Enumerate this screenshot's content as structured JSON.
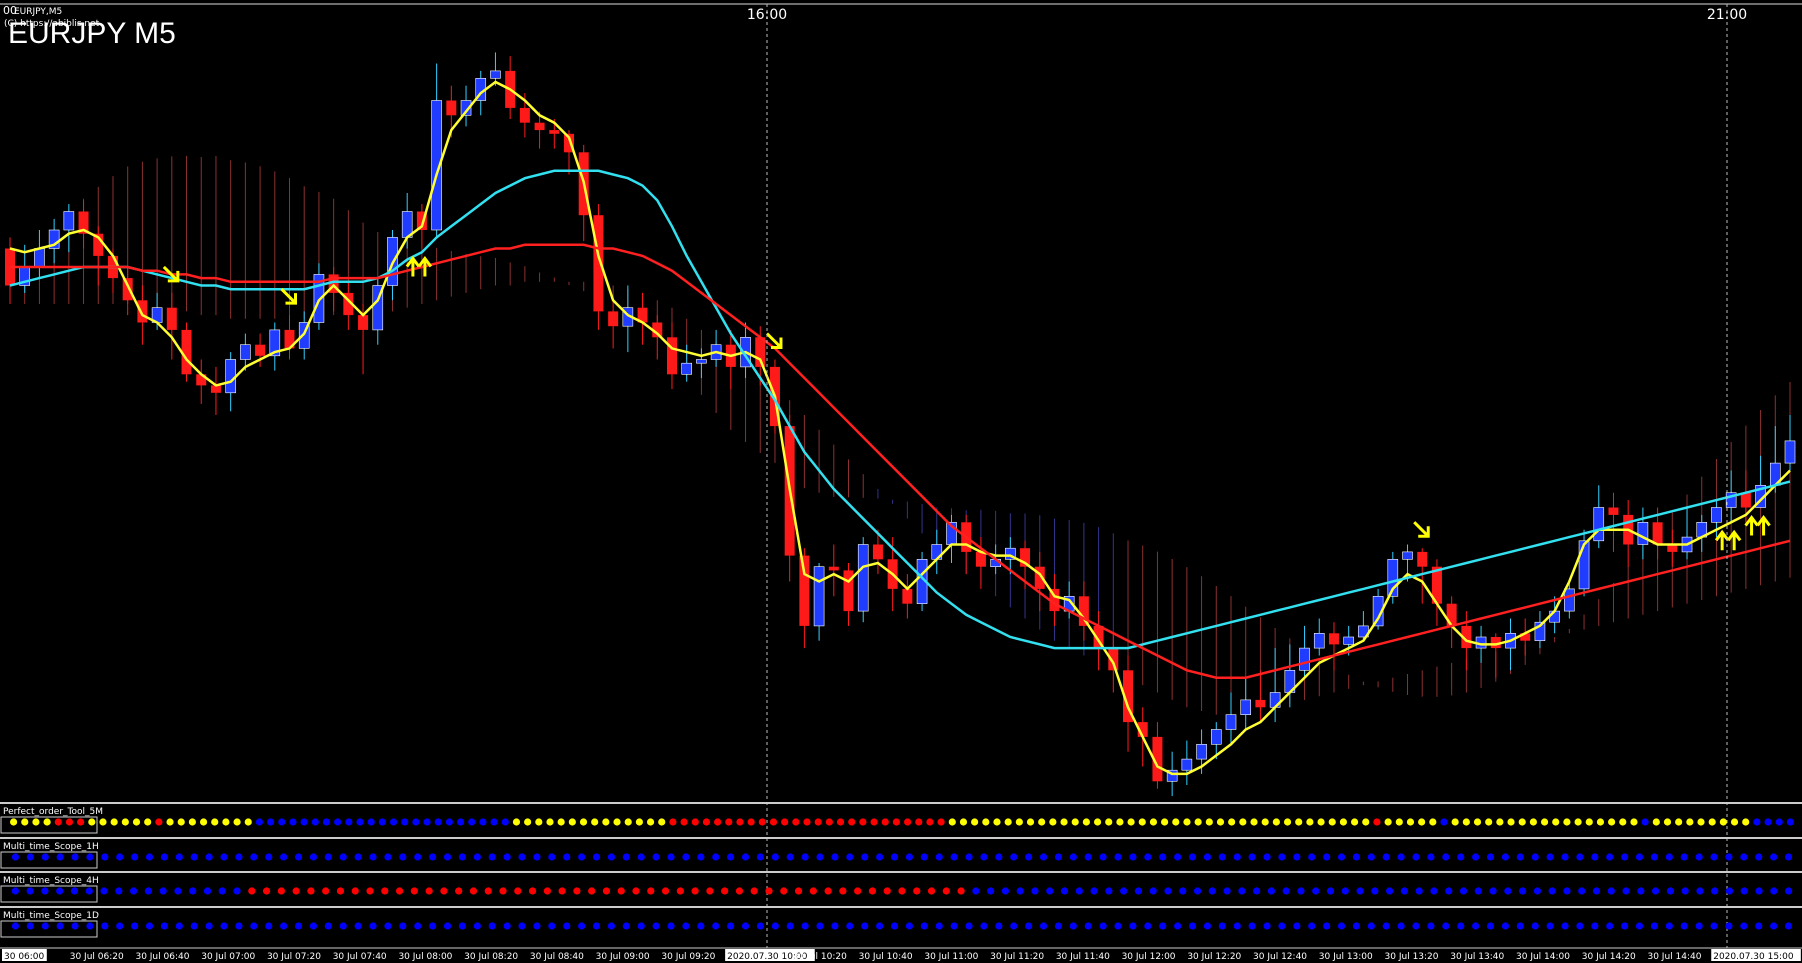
{
  "window": {
    "symbol_small": "EURJPY,M5",
    "copyright": "(C) https://abiblis.net",
    "title": "EURJPY M5",
    "corner_mark": "00"
  },
  "colors": {
    "bullish": "#1f3cff",
    "bearish": "#ff1a1a",
    "ema_fast": "#ffff33",
    "ema_mid": "#33e0f0",
    "ema_slow": "#ff2020",
    "cloud": "#ff5a5a",
    "cloud_alt": "#6060ff",
    "signal": "#ffff00",
    "dot_blue": "#0000ff",
    "dot_red": "#ff0000",
    "dot_yellow": "#ffff00"
  },
  "chart_data": {
    "type": "candlestick",
    "timeframe": "M5",
    "time_separators": [
      "16:00",
      "21:00"
    ],
    "x_ticks": [
      "30 06:00",
      "30 Jul 06:20",
      "30 Jul 06:40",
      "30 Jul 07:00",
      "30 Jul 07:20",
      "30 Jul 07:40",
      "30 Jul 08:00",
      "30 Jul 08:20",
      "30 Jul 08:40",
      "30 Jul 09:00",
      "30 Jul 09:20",
      "2020.07.30 10:00",
      "30 Jul 10:20",
      "30 Jul 10:40",
      "30 Jul 11:00",
      "30 Jul 11:20",
      "30 Jul 11:40",
      "30 Jul 12:00",
      "30 Jul 12:20",
      "30 Jul 12:40",
      "30 Jul 13:00",
      "30 Jul 13:20",
      "30 Jul 13:40",
      "30 Jul 14:00",
      "30 Jul 14:20",
      "30 Jul 14:40",
      "2020.07.30 15:00"
    ],
    "candles": [
      [
        62.0,
        61.9,
        62.03,
        61.85
      ],
      [
        61.9,
        61.95,
        62.01,
        61.88
      ],
      [
        61.95,
        62.0,
        62.05,
        61.92
      ],
      [
        62.0,
        62.05,
        62.08,
        61.96
      ],
      [
        62.05,
        62.1,
        62.12,
        61.99
      ],
      [
        62.1,
        62.04,
        62.13,
        62.0
      ],
      [
        62.04,
        61.98,
        62.06,
        61.9
      ],
      [
        61.98,
        61.92,
        62.0,
        61.88
      ],
      [
        61.92,
        61.86,
        61.95,
        61.82
      ],
      [
        61.86,
        61.8,
        61.9,
        61.74
      ],
      [
        61.8,
        61.84,
        61.88,
        61.78
      ],
      [
        61.84,
        61.78,
        61.88,
        61.7
      ],
      [
        61.78,
        61.66,
        61.8,
        61.64
      ],
      [
        61.66,
        61.63,
        61.7,
        61.58
      ],
      [
        61.63,
        61.61,
        61.68,
        61.55
      ],
      [
        61.61,
        61.7,
        61.72,
        61.56
      ],
      [
        61.7,
        61.74,
        61.77,
        61.67
      ],
      [
        61.74,
        61.71,
        61.77,
        61.68
      ],
      [
        61.71,
        61.78,
        61.8,
        61.67
      ],
      [
        61.78,
        61.73,
        61.82,
        61.7
      ],
      [
        61.73,
        61.8,
        61.83,
        61.7
      ],
      [
        61.8,
        61.93,
        61.96,
        61.78
      ],
      [
        61.93,
        61.88,
        61.95,
        61.83
      ],
      [
        61.88,
        61.82,
        61.91,
        61.78
      ],
      [
        61.82,
        61.78,
        61.85,
        61.66
      ],
      [
        61.78,
        61.9,
        61.92,
        61.74
      ],
      [
        61.9,
        62.03,
        62.05,
        61.86
      ],
      [
        62.03,
        62.1,
        62.15,
        62.0
      ],
      [
        62.1,
        62.05,
        62.12,
        62.0
      ],
      [
        62.05,
        62.4,
        62.5,
        62.03
      ],
      [
        62.4,
        62.36,
        62.44,
        62.3
      ],
      [
        62.36,
        62.4,
        62.44,
        62.33
      ],
      [
        62.4,
        62.46,
        62.48,
        62.36
      ],
      [
        62.46,
        62.48,
        62.53,
        62.44
      ],
      [
        62.48,
        62.38,
        62.52,
        62.35
      ],
      [
        62.38,
        62.34,
        62.42,
        62.3
      ],
      [
        62.34,
        62.32,
        62.37,
        62.27
      ],
      [
        62.32,
        62.31,
        62.35,
        62.27
      ],
      [
        62.31,
        62.26,
        62.32,
        62.2
      ],
      [
        62.26,
        62.09,
        62.28,
        62.02
      ],
      [
        62.09,
        61.83,
        62.12,
        61.78
      ],
      [
        61.83,
        61.79,
        61.86,
        61.73
      ],
      [
        61.79,
        61.84,
        61.9,
        61.72
      ],
      [
        61.84,
        61.8,
        61.88,
        61.74
      ],
      [
        61.8,
        61.76,
        61.82,
        61.7
      ],
      [
        61.76,
        61.66,
        61.8,
        61.62
      ],
      [
        61.66,
        61.69,
        61.74,
        61.64
      ],
      [
        61.69,
        61.7,
        61.73,
        61.65
      ],
      [
        61.7,
        61.74,
        61.78,
        61.68
      ],
      [
        61.74,
        61.68,
        61.78,
        61.62
      ],
      [
        61.68,
        61.76,
        61.8,
        61.65
      ],
      [
        61.76,
        61.68,
        61.79,
        61.63
      ],
      [
        61.68,
        61.52,
        61.7,
        61.5
      ],
      [
        61.52,
        61.17,
        61.55,
        61.1
      ],
      [
        61.17,
        60.98,
        61.19,
        60.92
      ],
      [
        60.98,
        61.14,
        61.15,
        60.94
      ],
      [
        61.14,
        61.13,
        61.2,
        61.06
      ],
      [
        61.13,
        61.02,
        61.15,
        60.98
      ],
      [
        61.02,
        61.2,
        61.22,
        60.99
      ],
      [
        61.2,
        61.16,
        61.24,
        61.12
      ],
      [
        61.16,
        61.08,
        61.22,
        61.02
      ],
      [
        61.08,
        61.04,
        61.12,
        61.0
      ],
      [
        61.04,
        61.16,
        61.18,
        61.02
      ],
      [
        61.16,
        61.2,
        61.24,
        61.12
      ],
      [
        61.2,
        61.26,
        61.28,
        61.15
      ],
      [
        61.26,
        61.18,
        61.28,
        61.12
      ],
      [
        61.18,
        61.14,
        61.22,
        61.08
      ],
      [
        61.14,
        61.16,
        61.2,
        61.12
      ],
      [
        61.16,
        61.19,
        61.22,
        61.12
      ],
      [
        61.19,
        61.14,
        61.21,
        61.08
      ],
      [
        61.14,
        61.08,
        61.18,
        61.02
      ],
      [
        61.08,
        61.02,
        61.12,
        60.98
      ],
      [
        61.02,
        61.06,
        61.1,
        61.0
      ],
      [
        61.06,
        60.98,
        61.1,
        60.94
      ],
      [
        60.98,
        60.92,
        61.02,
        60.86
      ],
      [
        60.92,
        60.86,
        60.96,
        60.8
      ],
      [
        60.86,
        60.72,
        60.9,
        60.64
      ],
      [
        60.72,
        60.68,
        60.76,
        60.6
      ],
      [
        60.68,
        60.56,
        60.72,
        60.54
      ],
      [
        60.56,
        60.59,
        60.64,
        60.52
      ],
      [
        60.59,
        60.62,
        60.67,
        60.55
      ],
      [
        60.62,
        60.66,
        60.7,
        60.58
      ],
      [
        60.66,
        60.7,
        60.72,
        60.62
      ],
      [
        60.7,
        60.74,
        60.8,
        60.66
      ],
      [
        60.74,
        60.78,
        60.84,
        60.7
      ],
      [
        60.78,
        60.76,
        60.86,
        60.72
      ],
      [
        60.76,
        60.8,
        60.92,
        60.72
      ],
      [
        60.8,
        60.86,
        60.93,
        60.76
      ],
      [
        60.86,
        60.92,
        60.98,
        60.84
      ],
      [
        60.92,
        60.96,
        61.0,
        60.9
      ],
      [
        60.96,
        60.93,
        60.99,
        60.86
      ],
      [
        60.93,
        60.95,
        60.98,
        60.9
      ],
      [
        60.95,
        60.98,
        61.02,
        60.94
      ],
      [
        60.98,
        61.06,
        61.08,
        60.97
      ],
      [
        61.06,
        61.16,
        61.18,
        61.04
      ],
      [
        61.16,
        61.18,
        61.2,
        61.1
      ],
      [
        61.18,
        61.14,
        61.19,
        61.04
      ],
      [
        61.14,
        61.04,
        61.16,
        60.98
      ],
      [
        61.04,
        60.98,
        61.06,
        60.92
      ],
      [
        60.98,
        60.92,
        61.02,
        60.86
      ],
      [
        60.92,
        60.95,
        60.98,
        60.88
      ],
      [
        60.95,
        60.92,
        60.96,
        60.84
      ],
      [
        60.92,
        60.96,
        61.0,
        60.86
      ],
      [
        60.96,
        60.94,
        61.0,
        60.9
      ],
      [
        60.94,
        60.99,
        61.02,
        60.92
      ],
      [
        60.99,
        61.02,
        61.06,
        60.96
      ],
      [
        61.02,
        61.08,
        61.1,
        61.0
      ],
      [
        61.08,
        61.21,
        61.24,
        61.06
      ],
      [
        61.21,
        61.3,
        61.36,
        61.19
      ],
      [
        61.3,
        61.28,
        61.34,
        61.18
      ],
      [
        61.28,
        61.2,
        61.32,
        61.14
      ],
      [
        61.2,
        61.26,
        61.3,
        61.16
      ],
      [
        61.26,
        61.2,
        61.3,
        61.16
      ],
      [
        61.2,
        61.18,
        61.24,
        61.14
      ],
      [
        61.18,
        61.22,
        61.3,
        61.16
      ],
      [
        61.22,
        61.26,
        61.28,
        61.18
      ],
      [
        61.26,
        61.3,
        61.32,
        61.22
      ],
      [
        61.3,
        61.34,
        61.4,
        61.26
      ],
      [
        61.34,
        61.3,
        61.4,
        61.26
      ],
      [
        61.3,
        61.36,
        61.44,
        61.3
      ],
      [
        61.36,
        61.42,
        61.52,
        61.34
      ],
      [
        61.42,
        61.48,
        61.55,
        61.4
      ]
    ],
    "series": [
      {
        "name": "",
        "role": "ema_fast",
        "values": [
          62.0,
          61.99,
          62.0,
          62.01,
          62.04,
          62.05,
          62.03,
          61.98,
          61.9,
          61.82,
          61.8,
          61.76,
          61.7,
          61.66,
          61.63,
          61.64,
          61.68,
          61.7,
          61.72,
          61.73,
          61.77,
          61.86,
          61.9,
          61.86,
          61.82,
          61.86,
          61.96,
          62.03,
          62.06,
          62.2,
          62.32,
          62.37,
          62.42,
          62.45,
          62.43,
          62.4,
          62.36,
          62.34,
          62.3,
          62.18,
          61.98,
          61.86,
          61.82,
          61.8,
          61.77,
          61.73,
          61.72,
          61.71,
          61.72,
          61.71,
          61.72,
          61.7,
          61.6,
          61.35,
          61.12,
          61.1,
          61.12,
          61.1,
          61.14,
          61.15,
          61.12,
          61.08,
          61.12,
          61.16,
          61.2,
          61.2,
          61.18,
          61.17,
          61.17,
          61.15,
          61.12,
          61.06,
          61.05,
          61.0,
          60.94,
          60.88,
          60.76,
          60.68,
          60.6,
          60.58,
          60.58,
          60.6,
          60.63,
          60.66,
          60.7,
          60.72,
          60.76,
          60.8,
          60.84,
          60.88,
          60.9,
          60.92,
          60.94,
          61.0,
          61.08,
          61.12,
          61.1,
          61.04,
          60.98,
          60.94,
          60.93,
          60.93,
          60.94,
          60.96,
          60.98,
          61.02,
          61.1,
          61.2,
          61.24,
          61.24,
          61.24,
          61.22,
          61.2,
          61.2,
          61.2,
          61.22,
          61.24,
          61.26,
          61.28,
          61.32,
          61.36,
          61.4
        ]
      },
      {
        "name": "",
        "role": "ema_mid",
        "values": [
          61.9,
          61.91,
          61.92,
          61.93,
          61.94,
          61.95,
          61.95,
          61.95,
          61.95,
          61.94,
          61.93,
          61.92,
          61.91,
          61.9,
          61.9,
          61.89,
          61.89,
          61.89,
          61.89,
          61.89,
          61.89,
          61.9,
          61.91,
          61.91,
          61.91,
          61.92,
          61.94,
          61.97,
          61.99,
          62.03,
          62.06,
          62.09,
          62.12,
          62.15,
          62.17,
          62.19,
          62.2,
          62.21,
          62.21,
          62.21,
          62.21,
          62.2,
          62.19,
          62.17,
          62.13,
          62.06,
          61.98,
          61.91,
          61.84,
          61.77,
          61.71,
          61.65,
          61.59,
          61.52,
          61.45,
          61.4,
          61.35,
          61.31,
          61.27,
          61.23,
          61.19,
          61.15,
          61.11,
          61.07,
          61.04,
          61.01,
          60.99,
          60.97,
          60.95,
          60.94,
          60.93,
          60.92,
          60.92,
          60.92,
          60.92,
          60.92,
          60.92,
          60.93,
          60.94,
          60.95,
          60.96,
          60.97,
          60.98,
          60.99,
          61.0,
          61.01,
          61.02,
          61.03,
          61.04,
          61.05,
          61.06,
          61.07,
          61.08,
          61.09,
          61.1,
          61.11,
          61.12,
          61.13,
          61.14,
          61.15,
          61.16,
          61.17,
          61.18,
          61.19,
          61.2,
          61.21,
          61.22,
          61.23,
          61.24,
          61.25,
          61.26,
          61.27,
          61.28,
          61.29,
          61.3,
          61.31,
          61.32,
          61.33,
          61.34,
          61.35,
          61.36,
          61.37
        ]
      },
      {
        "name": "",
        "role": "ema_slow",
        "values": [
          61.95,
          61.95,
          61.95,
          61.95,
          61.95,
          61.95,
          61.95,
          61.95,
          61.95,
          61.94,
          61.94,
          61.93,
          61.93,
          61.92,
          61.92,
          61.91,
          61.91,
          61.91,
          61.91,
          61.91,
          61.91,
          61.91,
          61.92,
          61.92,
          61.92,
          61.92,
          61.93,
          61.94,
          61.95,
          61.96,
          61.97,
          61.98,
          61.99,
          62.0,
          62.0,
          62.01,
          62.01,
          62.01,
          62.01,
          62.01,
          62.0,
          62.0,
          61.99,
          61.98,
          61.96,
          61.94,
          61.91,
          61.88,
          61.85,
          61.82,
          61.79,
          61.76,
          61.73,
          61.69,
          61.65,
          61.61,
          61.57,
          61.53,
          61.49,
          61.45,
          61.41,
          61.37,
          61.33,
          61.29,
          61.25,
          61.22,
          61.19,
          61.16,
          61.13,
          61.1,
          61.07,
          61.04,
          61.02,
          61.0,
          60.98,
          60.96,
          60.94,
          60.92,
          60.9,
          60.88,
          60.86,
          60.85,
          60.84,
          60.84,
          60.84,
          60.85,
          60.86,
          60.87,
          60.88,
          60.89,
          60.9,
          60.91,
          60.92,
          60.93,
          60.94,
          60.95,
          60.96,
          60.97,
          60.98,
          60.99,
          61.0,
          61.01,
          61.02,
          61.03,
          61.04,
          61.05,
          61.06,
          61.07,
          61.08,
          61.09,
          61.1,
          61.11,
          61.12,
          61.13,
          61.14,
          61.15,
          61.16,
          61.17,
          61.18,
          61.19,
          61.2,
          61.21
        ]
      }
    ],
    "signals": {
      "sell": [
        11,
        19,
        52,
        96
      ],
      "buy": [
        28,
        117,
        119
      ]
    },
    "indicator_panels": [
      {
        "label": "Perfect_order_Tool_5M",
        "dots": "YYYYRRRYYYYYYRYYYYYYYYBBBBBBBBBBBBBBBBBBBBBBBYYYYYYYYYYYYYYRRRRRRRRRRRRRRRRRRRRRRRRRYYYYYYYYYYYYYYYYYYYYYYYYYYYYYYYYYYYYYYRYYYYYBYYYYYYYYYYYYYYYYYBYYYYYYYYYBBBB"
      },
      {
        "label": "Multi_time_Scope_1H",
        "dots": "BBBBBBBBBBBBBBBBBBBBBBBBBBBBBBBBBBBBBBBBBBBBBBBBBBBBBBBBBBBBBBBBBBBBBBBBBBBBBBBBBBBBBBBBBBBBBBBBBBBBBBBBBBBBBBBBBBBBBBBB"
      },
      {
        "label": "Multi_time_Scope_4H",
        "dots": "BBBBBBBBBBBBBBBBRRRRRRRRRRRRRRRRRRRRRRRRRRRRRRRRRRRRRRRRRRRRRRRRRBBBBBBBBBBBBBBBBBBBBBBBBBBBBBBBBBBBBBBBBBBBBBBBBBBBBBBBB"
      },
      {
        "label": "Multi_time_Scope_1D",
        "dots": "BBBBBBBBBBBBBBBBBBBBBBBBBBBBBBBBBBBBBBBBBBBBBBBBBBBBBBBBBBBBBBBBBBBBBBBBBBBBBBBBBBBBBBBBBBBBBBBBBBBBBBBBBBBBBBBBBBBBBBBB"
      }
    ]
  }
}
